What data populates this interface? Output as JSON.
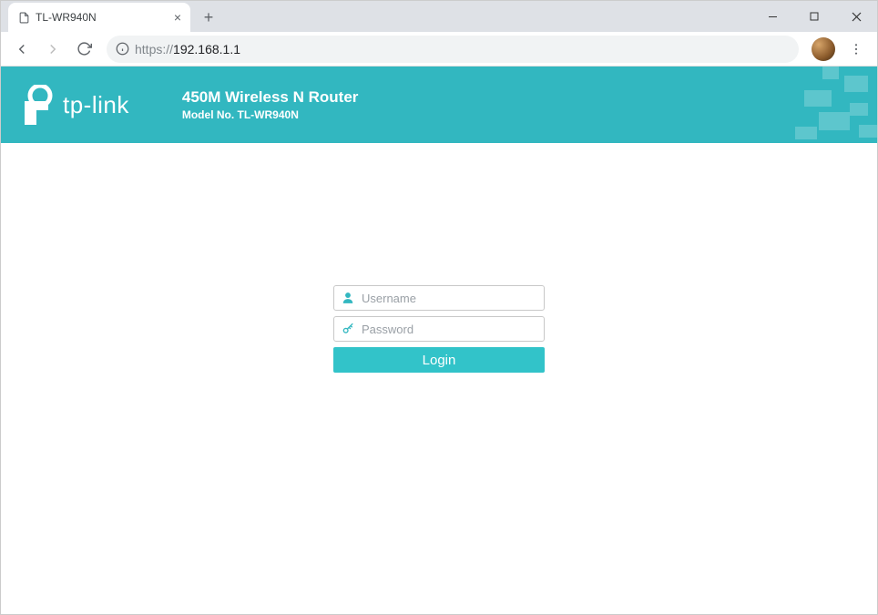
{
  "browser": {
    "tab_title": "TL-WR940N",
    "url_scheme": "https://",
    "url_host": "192.168.1.1"
  },
  "banner": {
    "brand": "tp-link",
    "product_title": "450M Wireless N Router",
    "product_model": "Model No. TL-WR940N"
  },
  "login": {
    "username_placeholder": "Username",
    "password_placeholder": "Password",
    "button_label": "Login"
  }
}
